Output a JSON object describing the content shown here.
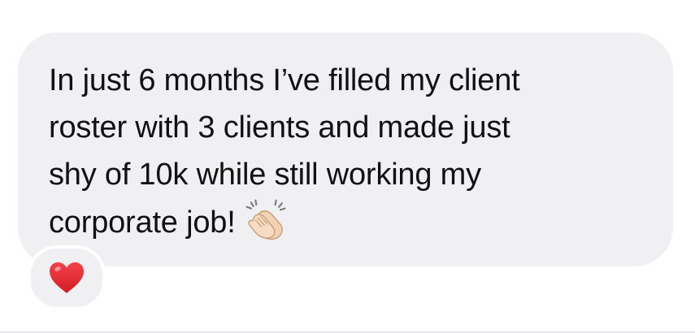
{
  "message": {
    "lines": [
      "In just 6 months I’ve filled my client",
      "roster with 3 clients and made just",
      "shy of 10k while still working my",
      "corporate job!"
    ],
    "emoji_icon": "clapping-hands-icon"
  },
  "reaction": {
    "icon": "red-heart-icon"
  },
  "colors": {
    "bubble": "#f0f0f3",
    "text": "#111111",
    "heart": "#e3242b"
  }
}
